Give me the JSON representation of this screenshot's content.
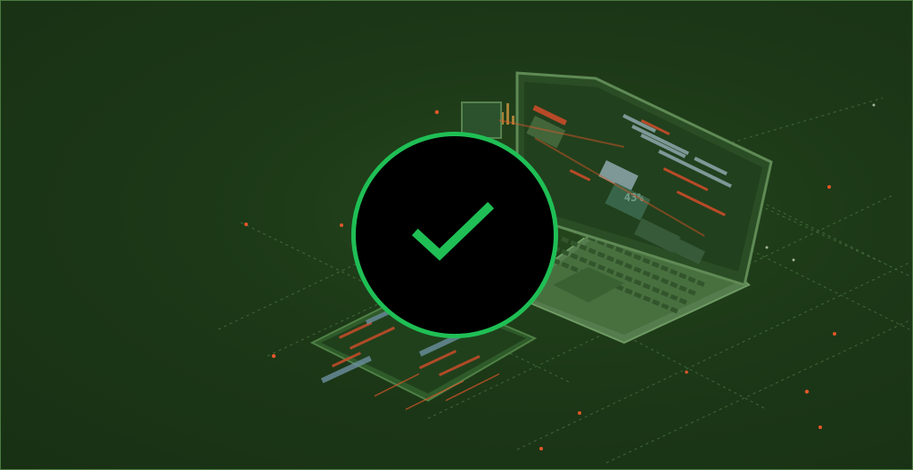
{
  "scene": {
    "description_text": "",
    "screen_readout": "43%",
    "status": "success"
  },
  "icons": {
    "center": "checkmark-icon",
    "device": "laptop-icon",
    "phone": "smartphone-icon"
  },
  "colors": {
    "background": "#1c3817",
    "badge_fill": "#000000",
    "badge_ring": "#1fbf55",
    "check": "#1fbf55",
    "accent_glow": "#e2572a",
    "grid_line": "#5e8f55"
  }
}
